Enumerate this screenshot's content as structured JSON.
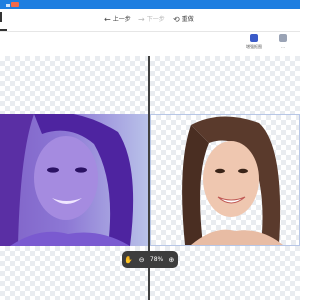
{
  "window": {
    "accent": "#1e7ee0"
  },
  "toolbar": {
    "undo_label": "上一步",
    "redo_label": "下一步",
    "reset_label": "重做"
  },
  "side_tools": {
    "bg_label": "增强抠图",
    "other_label": "..."
  },
  "zoom": {
    "level": "78%"
  },
  "icons": {
    "undo": "undo-arrow-icon",
    "redo": "redo-arrow-icon",
    "reset": "reset-clock-icon",
    "hand": "hand-icon",
    "zoom_out": "zoom-out-icon",
    "zoom_in": "zoom-in-icon"
  }
}
